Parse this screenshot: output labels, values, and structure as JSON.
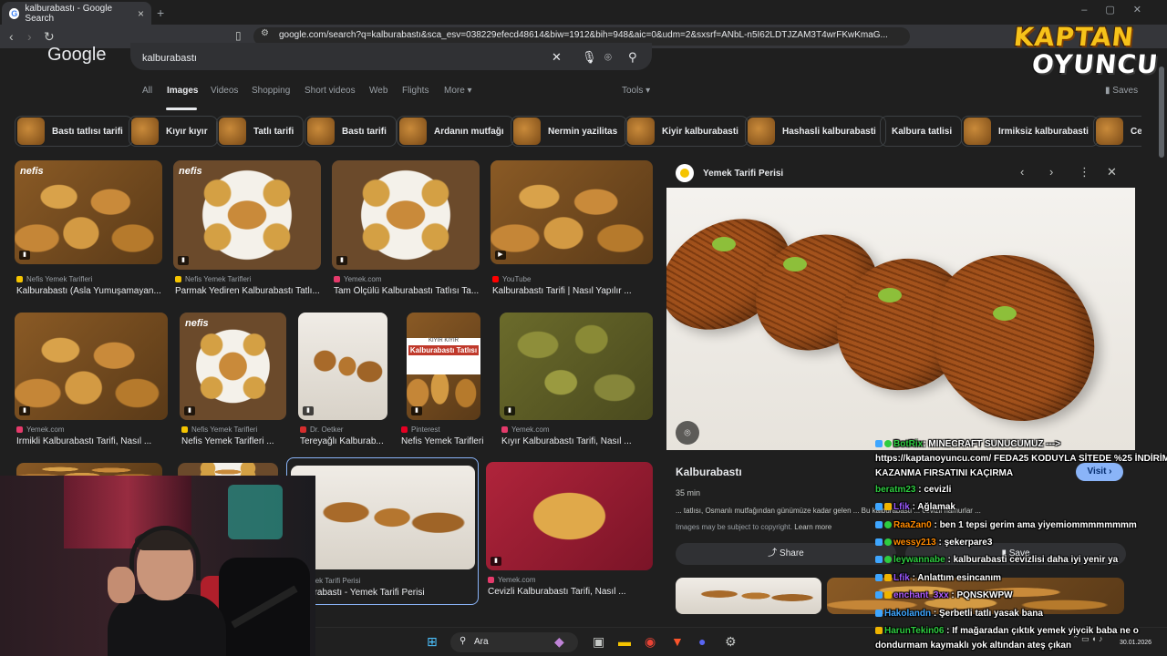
{
  "browser": {
    "tab_title": "kalburabastı - Google Search",
    "url": "google.com/search?q=kalburabastı&sca_esv=038229efecd48614&biw=1912&bih=948&aic=0&udm=2&sxsrf=ANbL-n5I62LDTJZAM3T4wrFKwKmaG..."
  },
  "google": {
    "logo": "Google",
    "query": "kalburabastı",
    "tabs": [
      "All",
      "Images",
      "Videos",
      "Shopping",
      "Short videos",
      "Web",
      "Flights",
      "More ▾"
    ],
    "tools": "Tools ▾",
    "saves": "Saves",
    "chips": [
      "Bastı tatlısı tarifi",
      "Kıyır kıyır",
      "Tatlı tarifi",
      "Bastı tarifi",
      "Ardanın mutfağı",
      "Nermin yazilitas",
      "Kiyir kalburabasti",
      "Hashasli kalburabasti",
      "Kalbura tatlisi",
      "Irmiksiz kalburabasti",
      "Ce"
    ]
  },
  "results": [
    {
      "source": "Nefis Yemek Tarifleri",
      "title": "Kalburabastı (Asla Yumuşamayan..."
    },
    {
      "source": "Nefis Yemek Tarifleri",
      "title": "Parmak Yediren Kalburabastı Tatlı..."
    },
    {
      "source": "Yemek.com",
      "title": "Tam Ölçülü Kalburabastı Tatlısı Ta..."
    },
    {
      "source": "YouTube",
      "title": "Kalburabastı Tarifi | Nasıl Yapılır ..."
    },
    {
      "source": "Yemek.com",
      "title": "İrmikli Kalburabastı Tarifi, Nasıl ..."
    },
    {
      "source": "Nefis Yemek Tarifleri",
      "title": "Nefis Yemek Tarifleri ..."
    },
    {
      "source": "Dr. Oetker",
      "title": "Tereyağlı Kalburab..."
    },
    {
      "source": "Pinterest",
      "title": "Nefis Yemek Tarifleri"
    },
    {
      "source": "Yemek.com",
      "title": "Kıyır Kalburabastı Tarifi, Nasıl ..."
    },
    {
      "source": "Yemek Tarifi Perisi",
      "title": "Kalburabastı - Yemek Tarifi Perisi"
    },
    {
      "source": "Yemek.com",
      "title": "Cevizli Kalburabastı Tarifi, Nasıl ..."
    }
  ],
  "overlay_texts": {
    "nefis": "nefis",
    "pinterest_banner_top": "KIYIR KIYIR",
    "pinterest_banner": "Kalburabastı Tatlısı"
  },
  "preview": {
    "site": "Yemek Tarifi Perisi",
    "title": "Kalburabastı",
    "visit": "Visit ›",
    "time": "35 min",
    "description": "... tatlısı, Osmanlı mutfağından günümüze kadar gelen ... Bu kalburabastı ... cevizli hamurlar ...",
    "copyright": "Images may be subject to copyright.",
    "learn_more": "Learn more",
    "share": "Share",
    "save": "Save"
  },
  "taskbar": {
    "search_placeholder": "Ara",
    "date": "30.01.2026"
  },
  "channel": {
    "line1": "KAPTAN",
    "line2": "OYUNCU"
  },
  "chat": [
    {
      "user": "BotRix",
      "text": ": MINECRAFT SUNUCUMUZ --->",
      "color": "#2ecc40"
    },
    {
      "user": "",
      "text": "https://kaptanoyuncu.com/ FEDA25 KODUYLA SİTEDE %25 İNDİRİM",
      "color": "#ffffff"
    },
    {
      "user": "",
      "text": "KAZANMA FIRSATINI KAÇIRMA",
      "color": "#ffffff"
    },
    {
      "user": "beratm23",
      "text": ": cevizli",
      "color": "#2ecc40"
    },
    {
      "user": "Lfik",
      "text": ": Ağlamak",
      "color": "#9b59ff"
    },
    {
      "user": "RaaZan0",
      "text": ": ben 1 tepsi gerim ama yiyemiommmmmmmm",
      "color": "#ff8a00"
    },
    {
      "user": "wessy213",
      "text": ": şekerpare3",
      "color": "#ff8a00"
    },
    {
      "user": "leywannabe",
      "text": ": kalburabasti cevizlisi daha iyi yenir ya",
      "color": "#2ecc40"
    },
    {
      "user": "Lfik",
      "text": ": Anlattım esincanım",
      "color": "#9b59ff"
    },
    {
      "user": "enchant_3xx",
      "text": ": PQNSKWPW",
      "color": "#b05cff"
    },
    {
      "user": "Hakolandn",
      "text": ": Şerbetli tatlı yasak bana",
      "color": "#3ea6ff"
    },
    {
      "user": "HarunTekin06",
      "text": ": If mağaradan çıktık yemek yiycik baba ne o",
      "color": "#2ecc40"
    },
    {
      "user": "",
      "text": "dondurmam kaymaklı yok altından ateş çıkan",
      "color": "#ffffff"
    }
  ]
}
